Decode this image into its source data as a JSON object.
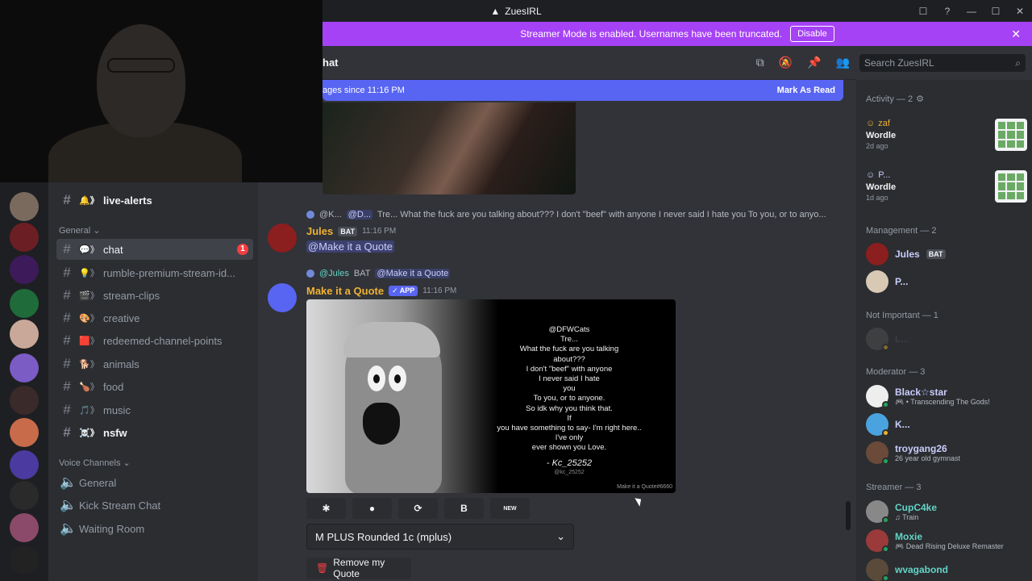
{
  "window": {
    "title": "ZuesIRL",
    "controls": [
      "☐",
      "?",
      "—",
      "☐",
      "✕"
    ]
  },
  "banner": {
    "text": "Streamer Mode is enabled. Usernames have been truncated.",
    "button": "Disable",
    "close": "✕"
  },
  "channel_header": {
    "name": "hat",
    "icons": [
      "threads-icon",
      "mute-icon",
      "pin-icon",
      "members-icon"
    ]
  },
  "search": {
    "placeholder": "Search ZuesIRL"
  },
  "new_messages": {
    "text": "ages since 11:16 PM",
    "mark_read": "Mark As Read"
  },
  "channels": {
    "items": [
      {
        "name": "live-alerts",
        "emoji": "🔔》",
        "bold": true
      },
      {
        "category": "General"
      },
      {
        "name": "chat",
        "emoji": "💬》",
        "active": true,
        "badge": "1"
      },
      {
        "name": "rumble-premium-stream-id...",
        "emoji": "💡》"
      },
      {
        "name": "stream-clips",
        "emoji": "🎬》"
      },
      {
        "name": "creative",
        "emoji": "🎨》"
      },
      {
        "name": "redeemed-channel-points",
        "emoji": "🟥》"
      },
      {
        "name": "animals",
        "emoji": "🐕》"
      },
      {
        "name": "food",
        "emoji": "🍗》"
      },
      {
        "name": "music",
        "emoji": "🎵》"
      },
      {
        "name": "nsfw",
        "emoji": "☠️》",
        "bold": true
      }
    ],
    "voice_category": "Voice Channels",
    "voice": [
      "General",
      "Kick Stream Chat",
      "Waiting Room"
    ]
  },
  "messages": {
    "reply1": {
      "user": "@K...",
      "mention": "@D...",
      "text": "Tre... What the fuck are you talking about??? I don't \"beef\" with anyone I never said I hate you  To you, or to anyo..."
    },
    "msg1": {
      "author": "Jules",
      "tag": "BAT",
      "time": "11:16 PM",
      "content": "@Make it a Quote"
    },
    "reply2": {
      "user": "@Jules",
      "tag": "BAT",
      "mention": "@Make it a Quote"
    },
    "msg2": {
      "author": "Make it a Quote",
      "tag": "✓ APP",
      "time": "11:16 PM"
    },
    "quote": {
      "lines": [
        "@DFWCats",
        "Tre...",
        "What the fuck are you talking",
        "about???",
        "I don't \"beef\" with anyone",
        "I never said I hate",
        "you",
        "To you, or to anyone.",
        "So idk why you think that.",
        "If",
        "you have something to say- I'm right here..",
        "I've only",
        "ever shown you Love."
      ],
      "signature": "- Kc_25252",
      "handle": "@kc_25252",
      "footer": "Make it a Quote#6660"
    },
    "buttons": [
      "✱",
      "●",
      "⟳",
      "B",
      "NEW"
    ],
    "font_select": "M PLUS Rounded 1c (mplus)",
    "remove": "Remove my Quote"
  },
  "members": {
    "activity_header": "Activity — 2",
    "activities": [
      {
        "user": "zaf",
        "game": "Wordle",
        "when": "2d ago"
      },
      {
        "user": "P...",
        "game": "Wordle",
        "when": "1d ago"
      }
    ],
    "groups": [
      {
        "label": "Management — 2",
        "members": [
          {
            "name": "Jules",
            "tag": "BAT",
            "color": "#c9cdfb",
            "sub": ""
          },
          {
            "name": "P...",
            "color": "#c9cdfb",
            "sub": ""
          }
        ]
      },
      {
        "label": "Not Important — 1",
        "members": [
          {
            "name": "L...",
            "color": "#4e5058",
            "sub": ""
          }
        ]
      },
      {
        "label": "Moderator — 3",
        "members": [
          {
            "name": "Black☆star",
            "color": "#c9cdfb",
            "sub": "🎮 • Transcending The Gods!"
          },
          {
            "name": "K...",
            "color": "#c9cdfb",
            "sub": ""
          },
          {
            "name": "troygang26",
            "color": "#c9cdfb",
            "sub": "26 year old gymnast"
          }
        ]
      },
      {
        "label": "Streamer — 3",
        "members": [
          {
            "name": "CupC4ke",
            "color": "#63d4c5",
            "sub": "♫ Train"
          },
          {
            "name": "Moxie",
            "color": "#63d4c5",
            "sub": "🎮 Dead Rising Deluxe Remaster"
          },
          {
            "name": "wvagabond",
            "color": "#63d4c5",
            "sub": ""
          }
        ]
      }
    ]
  },
  "colors": {
    "accent": "#5865f2",
    "banner": "#a642f5",
    "badge": "#f23f43",
    "jules": "#f0b232"
  }
}
